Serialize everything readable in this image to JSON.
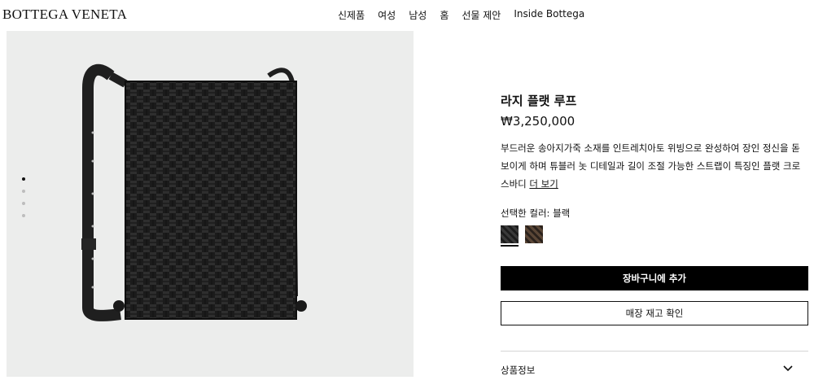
{
  "brand": {
    "logo": "BOTTEGA VENETA"
  },
  "nav": [
    "신제품",
    "여성",
    "남성",
    "홈",
    "선물 제안",
    "Inside Bottega"
  ],
  "product": {
    "title": "라지 플랫 루프",
    "price": "₩3,250,000",
    "description": "부드러운 송아지가죽 소재를 인트레치아토 위빙으로 완성하여 장인 정신을 돋보이게 하며 튜블러 놋 디테일과 길이 조절 가능한 스트랩이 특징인 플랫 크로스바디",
    "more_link": "더 보기",
    "color_label": "선택한 컬러: 블랙",
    "swatches": [
      {
        "name": "블랙",
        "color": "#1c1c1c"
      },
      {
        "name": "브라운",
        "color": "#3b3028"
      }
    ],
    "gallery": {
      "count": 4,
      "active": 0
    }
  },
  "actions": {
    "add_to_cart": "장바구니에 추가",
    "check_stock": "매장 재고 확인"
  },
  "accordion": {
    "product_info": "상품정보",
    "icon": "chevron-down-icon"
  }
}
